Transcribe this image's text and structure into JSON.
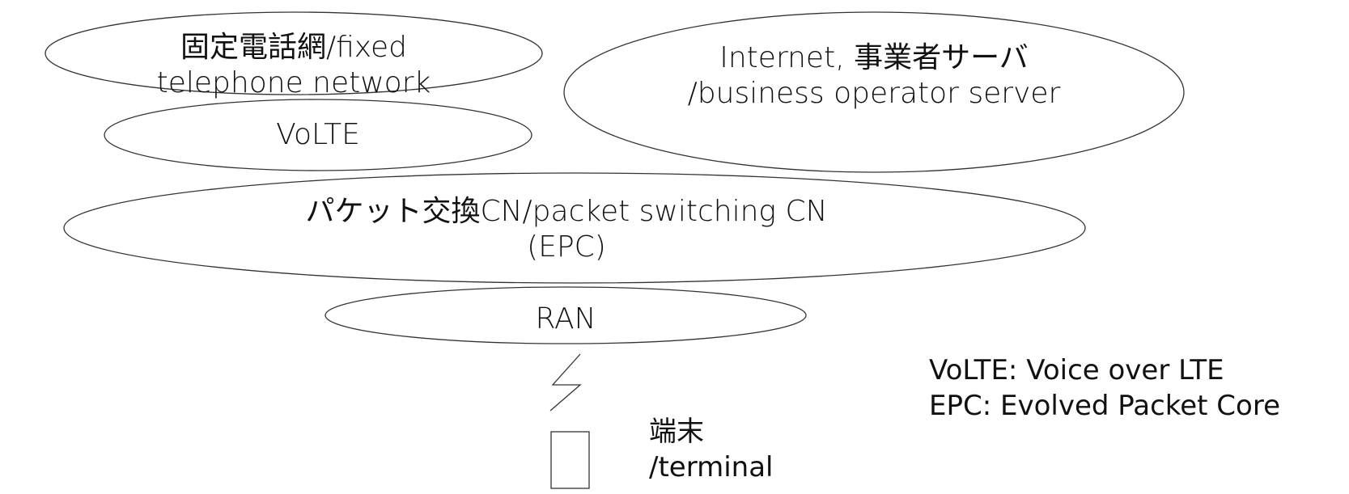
{
  "nodes": {
    "fixed_network": {
      "line1": "固定電話網/fixed",
      "line2": "telephone network"
    },
    "internet": {
      "line1": "Internet, 事業者サーバ",
      "line2": "/business operator server"
    },
    "volte": {
      "label": "VoLTE"
    },
    "epc": {
      "line1": "パケット交換CN/packet switching CN",
      "line2": "(EPC)"
    },
    "ran": {
      "label": "RAN"
    },
    "terminal": {
      "line1": "端末",
      "line2": "/terminal"
    }
  },
  "legend": {
    "volte": "VoLTE: Voice over LTE",
    "epc": "EPC: Evolved Packet Core"
  },
  "icons": [
    "lightning-icon",
    "terminal-device-icon"
  ],
  "colors": {
    "stroke": "#333333",
    "text": "#111111",
    "background": "#ffffff"
  }
}
